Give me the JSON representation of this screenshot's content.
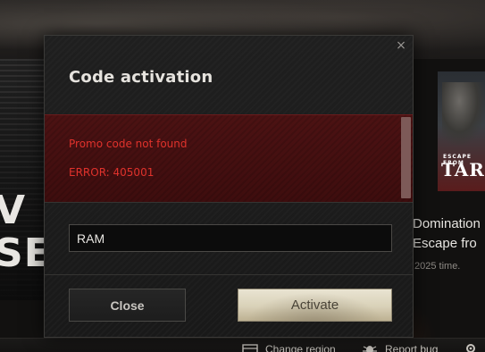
{
  "modal": {
    "title": "Code activation",
    "close_icon_glyph": "×",
    "error_messages": [
      "Promo code not found",
      "ERROR: 405001"
    ],
    "code_input_value": "RAM",
    "close_button_label": "Close",
    "activate_button_label": "Activate"
  },
  "background": {
    "left_banner_lines": [
      "V",
      "SE"
    ],
    "right_card_logo_sub": "ESCAPE FROM",
    "right_card_logo": "TARK",
    "news_title_lines": [
      "Domination |",
      "Escape fro"
    ],
    "news_meta": "2025 time."
  },
  "footer": {
    "change_region_label": "Change region",
    "report_bug_label": "Report bug"
  },
  "colors": {
    "error_text": "#e0322c",
    "error_panel": "#4c1213",
    "activate_button": "#d9d1b8"
  },
  "icons": [
    "close-icon",
    "change-region-icon",
    "report-bug-icon",
    "settings-icon"
  ]
}
